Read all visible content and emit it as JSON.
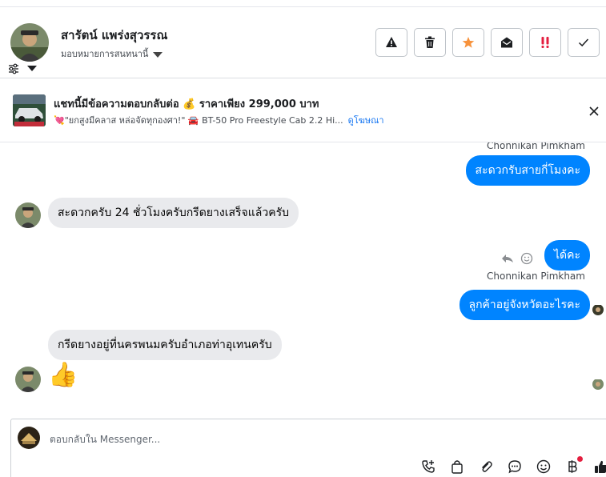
{
  "header": {
    "name": "สารัตน์ แพร่งสุวรรณ",
    "assign": "มอบหมายการสนทนานี้"
  },
  "actions": [
    {
      "name": "report-spam-button",
      "icon": "warning-icon"
    },
    {
      "name": "delete-button",
      "icon": "trash-icon"
    },
    {
      "name": "star-button",
      "icon": "star-icon"
    },
    {
      "name": "mark-unread-button",
      "icon": "envelope-open-icon"
    },
    {
      "name": "follow-up-button",
      "icon": "double-exclamation-icon"
    },
    {
      "name": "done-button",
      "icon": "check-icon"
    }
  ],
  "ad": {
    "title": "แชทนี้มีข้อความตอบกลับต่อ 💰 ราคาเพียง 299,000 บาท",
    "line": "💘\"ยกสูงมีคลาส หล่อจัดทุกองศา!\" 🚘 BT-50 Pro Freestyle Cab 2.2 Hi...",
    "link": "ดูโฆษณา"
  },
  "messages": {
    "m1_sender": "Chonnikan Pimkham",
    "m1": "สะดวกรับสายกี่โมงคะ",
    "m2": "สะดวกครับ 24 ชั่วโมงครับกรีดยางเสร็จแล้วครับ",
    "m3": "ได้คะ",
    "m4_sender": "Chonnikan Pimkham",
    "m4": "ลูกค้าอยู่จังหวัดอะไรคะ",
    "m5": "กรีดยางอยู่ที่นครพนมครับอำเภอท่าอุเทนครับ",
    "m6": "👍"
  },
  "composer": {
    "placeholder": "ตอบกลับใน Messenger..."
  },
  "colors": {
    "accent": "#0084ff",
    "incoming": "#e9eaed",
    "star": "#f7923b",
    "alert": "#e41e3f"
  }
}
